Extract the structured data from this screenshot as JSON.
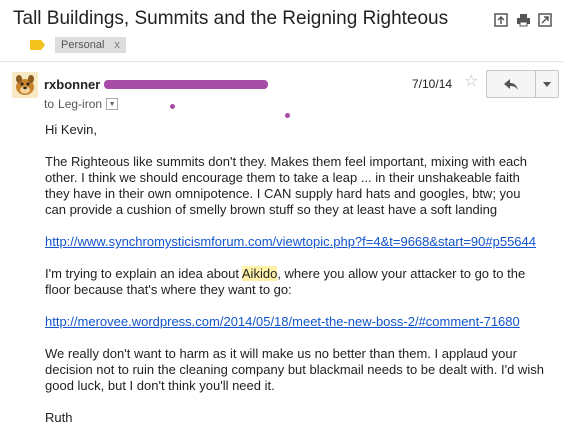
{
  "subject": "Tall Buildings, Summits and the Reigning Righteous",
  "labels": [
    {
      "name": "Personal",
      "remove": "x"
    }
  ],
  "message": {
    "sender_name": "rxbonner",
    "to_prefix": "to",
    "to_name": "Leg-iron",
    "date": "7/10/14",
    "greeting": "Hi Kevin,",
    "p1": "The Righteous like summits don't they.  Makes them feel important, mixing with each other.  I think we should encourage them to take a leap ... in their unshakeable faith they have in their own omnipotence.  I CAN supply hard hats and googles, btw; you can provide a cushion of smelly brown stuff so they at least have a soft landing",
    "link1": "http://www.synchromysticismforum.com/viewtopic.php?f=4&t=9668&start=90#p55644",
    "p2_before": "I'm trying to explain an idea about ",
    "p2_highlight": "Aikido",
    "p2_after": ", where you allow your attacker to go to the floor because that's where they want to go:",
    "link2": "http://merovee.wordpress.com/2014/05/18/meet-the-new-boss-2/#comment-71680",
    "p3": "We really don't want to harm as it will make us no better than them.  I applaud your decision not to ruin the cleaning company but blackmail needs to be dealt with.  I'd wish good luck, but I don't think you'll need it.",
    "signature": "Ruth"
  },
  "icons": {
    "archive": "archive-icon",
    "print": "print-icon",
    "new_window": "new-window-icon",
    "star": "star-icon",
    "reply": "reply-icon",
    "more": "chevron-down-icon"
  },
  "colors": {
    "link": "#1155cc",
    "importance": "#f4c21d",
    "redaction": "#a64ca6",
    "highlight": "#fff2a8"
  }
}
